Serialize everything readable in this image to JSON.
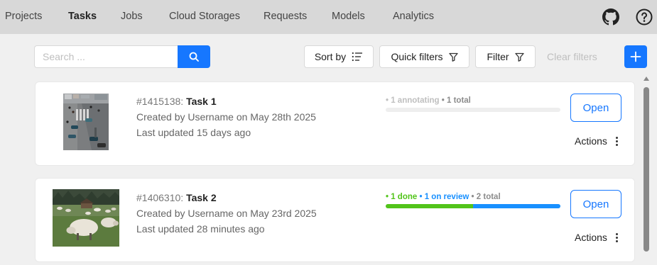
{
  "nav": {
    "items": [
      "Projects",
      "Tasks",
      "Jobs",
      "Cloud Storages",
      "Requests",
      "Models",
      "Analytics"
    ],
    "active": "Tasks"
  },
  "header_icons": [
    "github-icon",
    "help-icon"
  ],
  "toolbar": {
    "search_placeholder": "Search ...",
    "sort_label": "Sort by",
    "quick_filters_label": "Quick filters",
    "filter_label": "Filter",
    "clear_filters_label": "Clear filters"
  },
  "colors": {
    "primary": "#1677ff",
    "done": "#52c41a",
    "review": "#1890ff",
    "muted": "#bfbfbf"
  },
  "tasks": [
    {
      "id": "#1415138:",
      "name": "Task 1",
      "created": "Created by Username on May 28th 2025",
      "updated": "Last updated 15 days ago",
      "status": [
        {
          "text": "• 1 annotating",
          "color": "#bfbfbf"
        },
        {
          "text": " • 1 total",
          "color": "#8c8c8c"
        }
      ],
      "progress": {
        "done_fraction": 0,
        "review_fraction": 0
      },
      "open_label": "Open",
      "actions_label": "Actions"
    },
    {
      "id": "#1406310:",
      "name": "Task 2",
      "created": "Created by Username on May 23rd 2025",
      "updated": "Last updated 28 minutes ago",
      "status": [
        {
          "text": "• 1 done",
          "color": "#52c41a"
        },
        {
          "text": " • 1 on review",
          "color": "#1890ff"
        },
        {
          "text": " • 2 total",
          "color": "#8c8c8c"
        }
      ],
      "progress": {
        "done_fraction": 0.5,
        "review_fraction": 0.5
      },
      "open_label": "Open",
      "actions_label": "Actions"
    }
  ]
}
